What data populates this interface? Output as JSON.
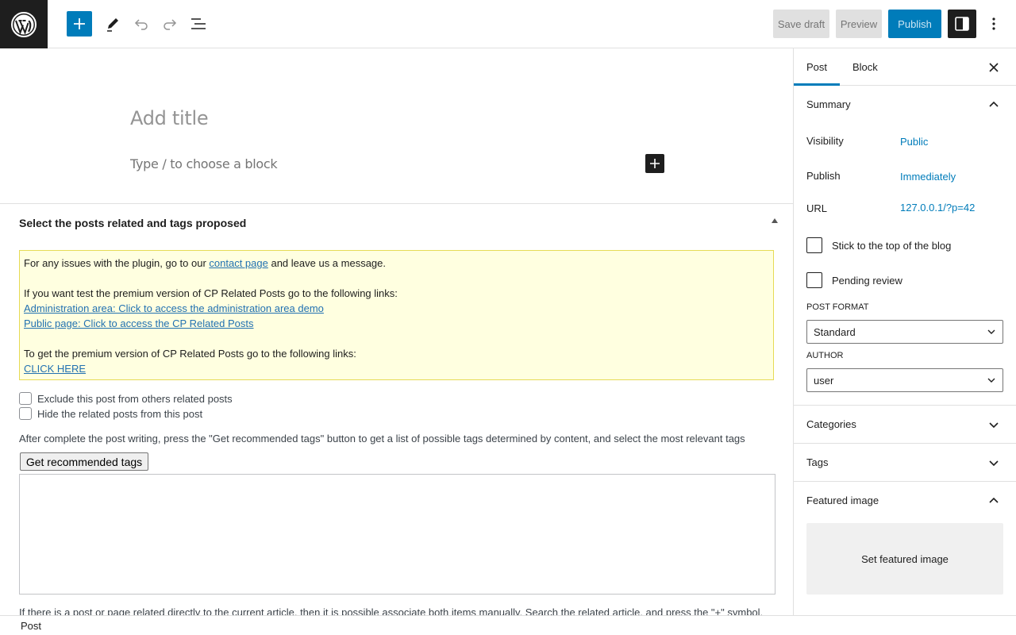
{
  "toolbar": {
    "save_draft": "Save draft",
    "preview": "Preview",
    "publish": "Publish"
  },
  "editor": {
    "title_placeholder": "Add title",
    "block_placeholder": "Type / to choose a block"
  },
  "metabox": {
    "title": "Select the posts related and tags proposed",
    "notice": {
      "line1_pre": "For any issues with the plugin, go to our ",
      "line1_link": "contact page",
      "line1_post": " and leave us a message.",
      "line2": "If you want test the premium version of CP Related Posts go to the following links:",
      "link_admin": "Administration area: Click to access the administration area demo",
      "link_public": "Public page: Click to access the CP Related Posts",
      "line3": "To get the premium version of CP Related Posts go to the following links:",
      "link_click": "CLICK HERE"
    },
    "exclude_label": "Exclude this post from others related posts",
    "hide_label": "Hide the related posts from this post",
    "help_text": "After complete the post writing, press the \"Get recommended tags\" button to get a list of possible tags determined by content, and select the most relevant tags",
    "get_tags_button": "Get recommended tags",
    "help_text2": "If there is a post or page related directly to the current article, then it is possible associate both items manually. Search the related article, and press the \"+\" symbol."
  },
  "footer": {
    "breadcrumb": "Post"
  },
  "sidebar": {
    "tabs": [
      "Post",
      "Block"
    ],
    "summary": {
      "title": "Summary",
      "visibility_label": "Visibility",
      "visibility_value": "Public",
      "publish_label": "Publish",
      "publish_value": "Immediately",
      "url_label": "URL",
      "url_value": "127.0.0.1/?p=42",
      "stick_label": "Stick to the top of the blog",
      "pending_label": "Pending review",
      "post_format_label": "POST FORMAT",
      "post_format_value": "Standard",
      "author_label": "AUTHOR",
      "author_value": "user"
    },
    "categories": "Categories",
    "tags": "Tags",
    "featured_image": {
      "title": "Featured image",
      "button": "Set featured image"
    }
  },
  "colors": {
    "accent": "#007cba",
    "notice_bg": "#ffffe0",
    "notice_border": "#e6db55",
    "dark": "#1e1e1e"
  }
}
